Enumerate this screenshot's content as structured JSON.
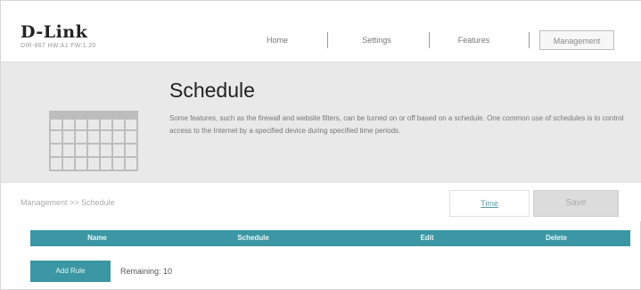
{
  "brand": {
    "logo": "D-Link",
    "model": "DIR-867 HW:A1 FW:1.20"
  },
  "nav": {
    "items": [
      "Home",
      "Settings",
      "Features",
      "Management"
    ]
  },
  "banner": {
    "title": "Schedule",
    "description": "Some features, such as the firewall and website filters, can be turned on or off based on a schedule. One common use of schedules is to control access to the Internet by a specified device during specified time periods."
  },
  "toolbar": {
    "breadcrumb": "Management >> Schedule",
    "time_label": "Time",
    "save_label": "Save"
  },
  "table": {
    "headers": [
      "Name",
      "Schedule",
      "Edit",
      "Delete"
    ]
  },
  "rules": {
    "add_label": "Add Rule",
    "remaining_text": "Remaining: 10"
  },
  "colors": {
    "accent": "#3a97a3",
    "banner_bg": "#e9e9e9"
  },
  "icons": {
    "banner_icon": "calendar-icon"
  }
}
